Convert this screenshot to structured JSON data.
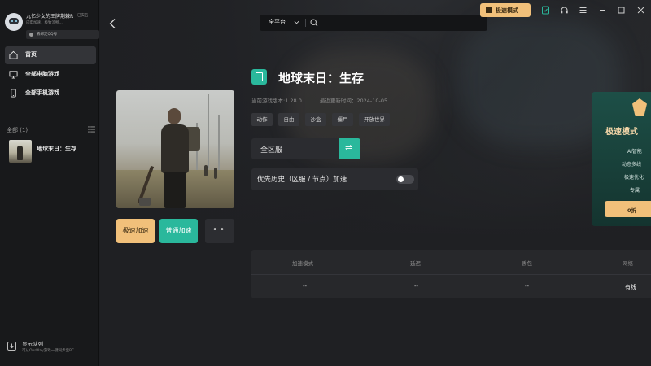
{
  "user": {
    "name": "九亿少女的王牌荆棘R",
    "tag": "已实名",
    "desc": "闪电加速，极致流畅...",
    "qq_bind": "去绑定QQ号"
  },
  "sidebar": {
    "items": [
      {
        "label": "首页",
        "icon": "home-icon"
      },
      {
        "label": "全部电脑游戏",
        "icon": "monitor-icon"
      },
      {
        "label": "全部手机游戏",
        "icon": "phone-icon"
      }
    ],
    "section_label": "全部 (1)",
    "games": [
      {
        "name": "地球末日：生存"
      }
    ],
    "queue": {
      "title": "显示队列",
      "subtitle": "可从OurPlay游戏一键同步至PC"
    }
  },
  "search": {
    "platform": "全平台"
  },
  "topbar": {
    "mode_label": "极速模式"
  },
  "game": {
    "title": "地球末日：生存",
    "version": "当前游戏版本:1.28.0",
    "updated": "最近更新时间：2024-10-05",
    "tags": [
      "动作",
      "自由",
      "沙盒",
      "僵尸",
      "开放世界"
    ],
    "server": "全区服",
    "priority_label": "优先历史（区服 / 节点）加速",
    "priority_enabled": false
  },
  "actions": {
    "fast": "极速加速",
    "normal": "普通加速",
    "more": "••"
  },
  "stats": {
    "headers": [
      "加速模式",
      "延迟",
      "丢包",
      "网络"
    ],
    "values": [
      "--",
      "--",
      "--",
      "有线"
    ]
  },
  "promo": {
    "title": "极速模式",
    "lines": [
      "AI智能",
      "动态多线",
      "极速优化",
      "专属"
    ],
    "button": "0折"
  },
  "colors": {
    "accent_teal": "#2ab89c",
    "accent_gold": "#f1c07a",
    "bg": "#1f2023"
  }
}
